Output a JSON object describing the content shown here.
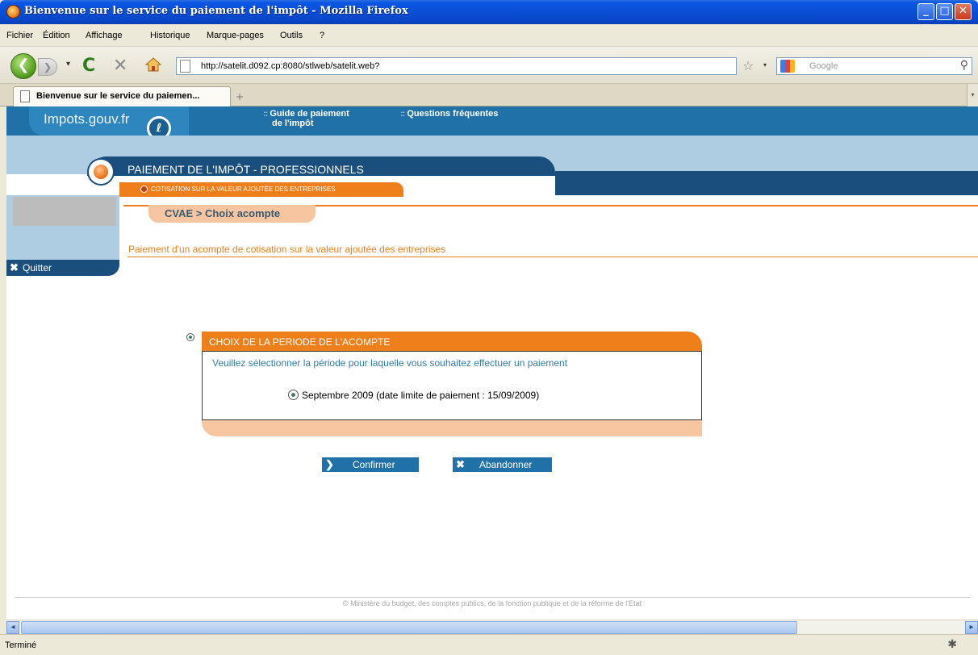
{
  "window": {
    "title": "Bienvenue sur le service du paiement de l'impôt - Mozilla Firefox",
    "min_glyph": "_",
    "max_glyph": "□",
    "close_glyph": "✕"
  },
  "menu": {
    "items": [
      "Fichier",
      "Édition",
      "Affichage",
      "Historique",
      "Marque-pages",
      "Outils",
      "?"
    ]
  },
  "toolbar": {
    "back_glyph": "❮",
    "forward_glyph": "❯",
    "dropdown_glyph": "▾",
    "reload_glyph": "C",
    "stop_glyph": "✕",
    "url": "http://satelit.d092.cp:8080/stlweb/satelit.web?",
    "star_glyph": "☆",
    "search_placeholder": "Google",
    "search_glyph": "⚲"
  },
  "tabs": {
    "active_label": "Bienvenue sur le service du paiemen...",
    "new_tab_glyph": "+",
    "scroll_glyph": "▾"
  },
  "site": {
    "logo_text": "Impots.gouv.fr",
    "logo_badge": "ℓ",
    "nav": {
      "guide_line1": "Guide de paiement",
      "guide_line2": "de l'impôt",
      "faq": "Questions fréquentes",
      "dots": "::"
    },
    "section_title": "PAIEMENT DE L'IMPÔT - PROFESSIONNELS",
    "subsection": "COTISATION SUR LA VALEUR AJOUTÉE DES ENTREPRISES",
    "quit_label": "Quitter",
    "quit_glyph": "✖",
    "breadcrumb": "CVAE > Choix acompte",
    "description": "Paiement d'un acompte de cotisation sur la valeur ajoutée des entreprises"
  },
  "period_box": {
    "header": "CHOIX DE LA PERIODE DE L'ACOMPTE",
    "question": "Veuillez sélectionner la période pour laquelle vous souhaitez effectuer un paiement",
    "option_label": "Septembre 2009 (date limite de paiement : 15/09/2009)",
    "option_selected": true
  },
  "buttons": {
    "confirm": "Confirmer",
    "confirm_glyph": "❯",
    "abandon": "Abandonner",
    "abandon_glyph": "✖"
  },
  "footer": {
    "text": "© Ministère du budget, des comptes publics, de la fonction publique et de la réforme de l'Etat"
  },
  "scrollbar": {
    "left_glyph": "◂",
    "right_glyph": "▸"
  },
  "status": {
    "text": "Terminé",
    "bug_glyph": "✱"
  }
}
